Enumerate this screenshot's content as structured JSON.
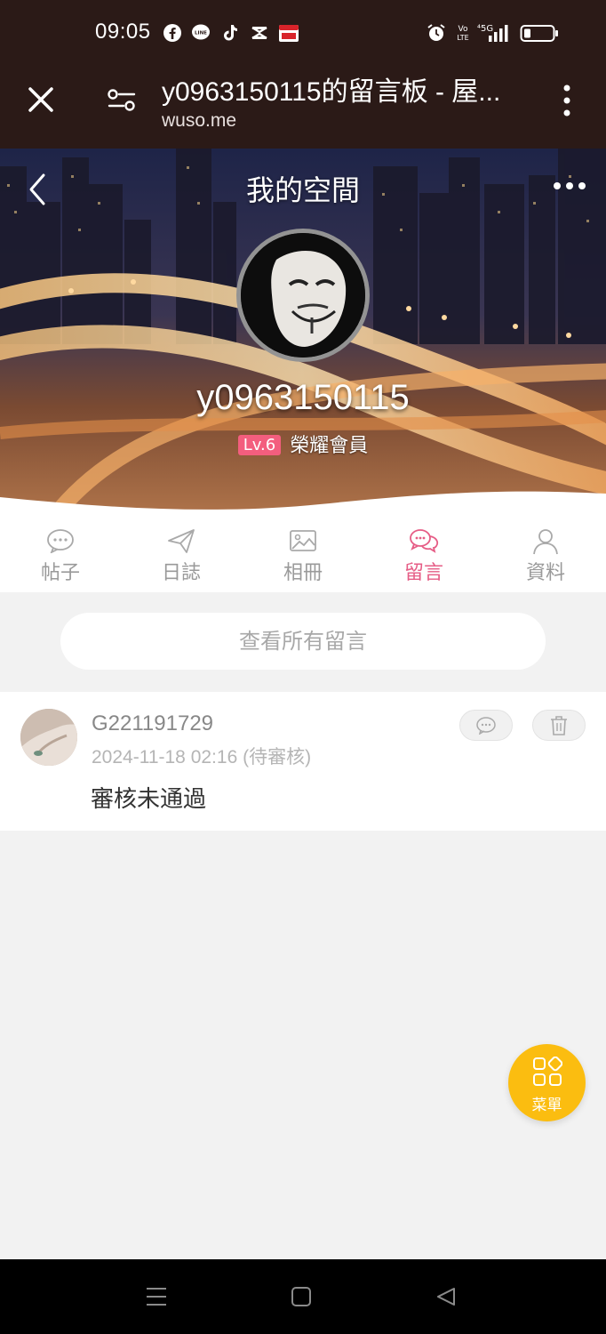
{
  "status_bar": {
    "time": "09:05",
    "app_icons": [
      "facebook-icon",
      "line-icon",
      "tiktok-icon",
      "capcut-icon",
      "calendar-app-icon"
    ],
    "system_icons": [
      "alarm-icon",
      "volte-icon",
      "5g-signal-icon",
      "battery-icon"
    ]
  },
  "browser": {
    "title": "y0963150115的留言板 - 屋...",
    "url": "wuso.me"
  },
  "profile": {
    "heading": "我的空間",
    "username": "y0963150115",
    "level": "Lv.6",
    "rank": "榮耀會員"
  },
  "tabs": [
    {
      "label": "帖子",
      "icon": "chat-bubble-icon",
      "active": false
    },
    {
      "label": "日誌",
      "icon": "paper-plane-icon",
      "active": false
    },
    {
      "label": "相冊",
      "icon": "image-icon",
      "active": false
    },
    {
      "label": "留言",
      "icon": "message-icon",
      "active": true
    },
    {
      "label": "資料",
      "icon": "person-icon",
      "active": false
    }
  ],
  "view_all_label": "查看所有留言",
  "messages": [
    {
      "author": "G221191729",
      "meta": "2024-11-18 02:16 (待審核)",
      "content": "審核未通過"
    }
  ],
  "menu_label": "菜單",
  "colors": {
    "accent": "#e65d86",
    "level_badge": "#f35e7e",
    "menu_button": "#fbbd10",
    "top_bar": "#2b1a17"
  }
}
